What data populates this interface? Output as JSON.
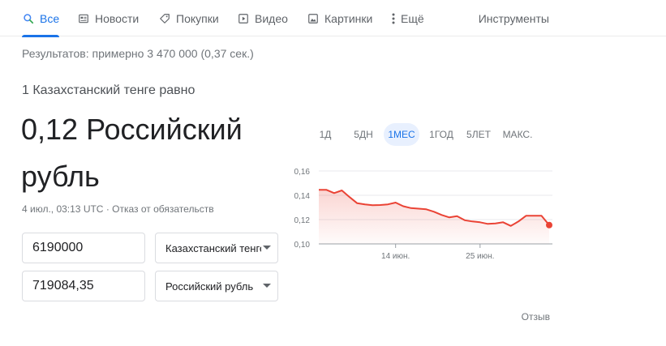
{
  "nav": {
    "items": [
      {
        "label": "Все",
        "icon": "search-icon",
        "active": true
      },
      {
        "label": "Новости",
        "icon": "newspaper-icon",
        "active": false
      },
      {
        "label": "Покупки",
        "icon": "tag-icon",
        "active": false
      },
      {
        "label": "Видео",
        "icon": "video-icon",
        "active": false
      },
      {
        "label": "Картинки",
        "icon": "image-icon",
        "active": false
      },
      {
        "label": "Ещё",
        "icon": "more-vert-icon",
        "active": false
      }
    ],
    "tools": "Инструменты"
  },
  "results_stats": "Результатов: примерно 3 470 000 (0,37 сек.)",
  "converter": {
    "title": "1 Казахстанский тенге равно",
    "result": "0,12 Российский рубль",
    "timestamp": "4 июл., 03:13 UTC",
    "separator": " · ",
    "disclaimer": "Отказ от обязательств",
    "from_value": "6190000",
    "from_currency": "Казахстанский тенге",
    "to_value": "719084,35",
    "to_currency": "Российский рубль"
  },
  "ranges": [
    {
      "label": "1Д",
      "active": false
    },
    {
      "label": "5ДН",
      "active": false
    },
    {
      "label": "1МЕС",
      "active": true
    },
    {
      "label": "1ГОД",
      "active": false
    },
    {
      "label": "5ЛЕТ",
      "active": false
    },
    {
      "label": "МАКС.",
      "active": false
    }
  ],
  "chart_data": {
    "type": "area",
    "y_ticks": [
      "0,16",
      "0,14",
      "0,12",
      "0,10"
    ],
    "x_ticks": [
      "14 июн.",
      "25 июн."
    ],
    "ylim": [
      0.1,
      0.16
    ],
    "color": "#ea4335",
    "values": [
      0.1445,
      0.1445,
      0.1418,
      0.144,
      0.1385,
      0.1335,
      0.1325,
      0.1318,
      0.132,
      0.1325,
      0.134,
      0.131,
      0.1295,
      0.129,
      0.1285,
      0.1265,
      0.1238,
      0.1218,
      0.1228,
      0.1195,
      0.1185,
      0.1178,
      0.1165,
      0.1168,
      0.1178,
      0.1148,
      0.1185,
      0.1232,
      0.1232,
      0.1232,
      0.1155
    ]
  },
  "feedback": "Отзыв"
}
